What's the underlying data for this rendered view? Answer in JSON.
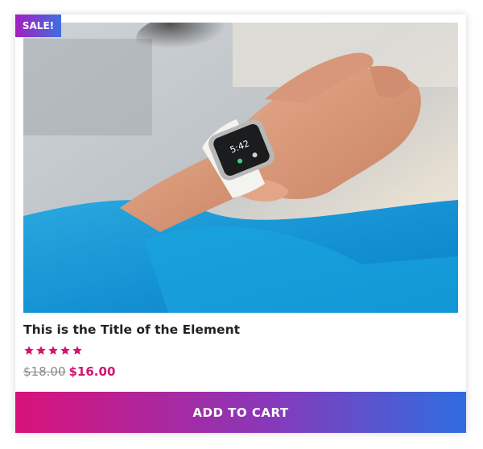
{
  "badge": {
    "label": "SALE!"
  },
  "product": {
    "title": "This is the Title of the Element",
    "rating": 5,
    "rating_max": 5,
    "old_price": "$18.00",
    "new_price": "$16.00",
    "image_icon": "smartwatch-on-wrist-photo"
  },
  "cart": {
    "label": "ADD TO CART"
  },
  "colors": {
    "accent": "#d4136e",
    "gradient_start": "#d9127a",
    "gradient_end": "#2f6de0",
    "star": "#d4136e"
  }
}
